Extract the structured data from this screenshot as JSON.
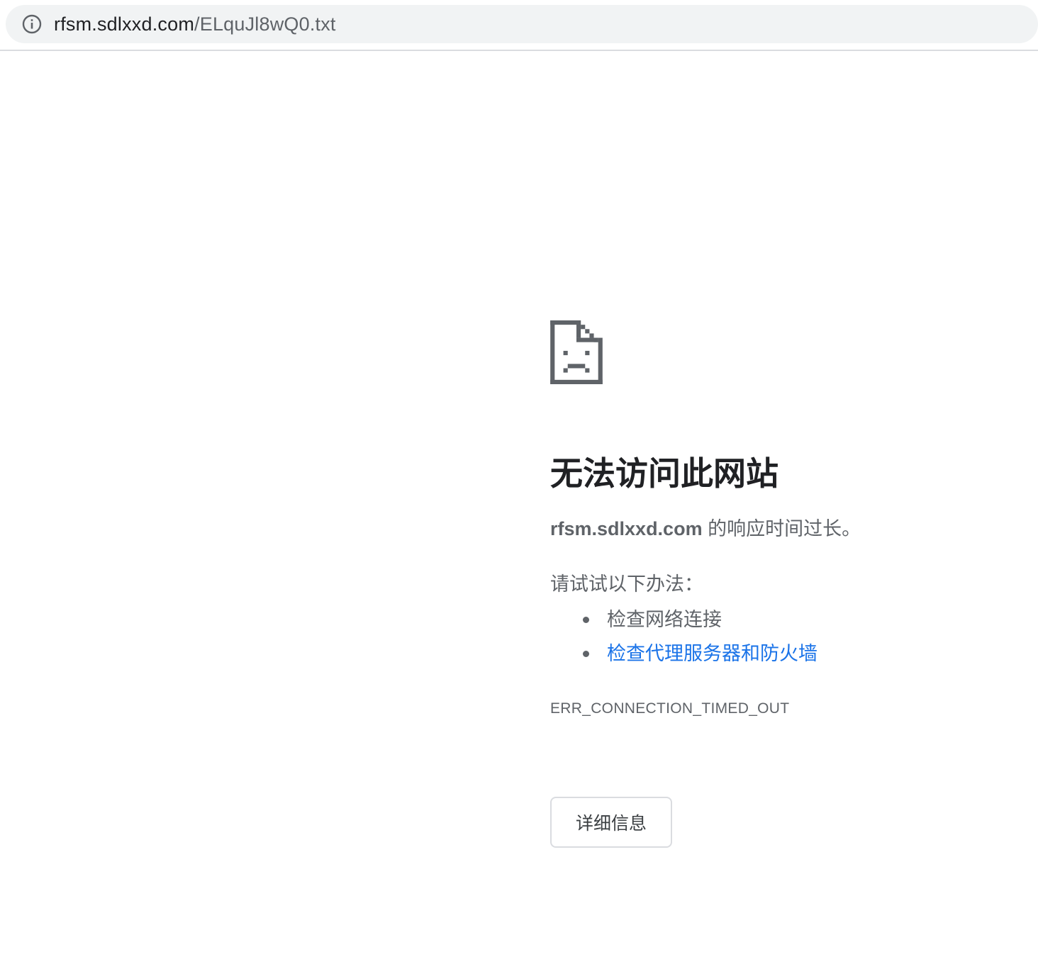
{
  "browser": {
    "url_host": "rfsm.sdlxxd.com",
    "url_path": "/ELquJl8wQ0.txt",
    "icons": {
      "site_info": "info-icon"
    }
  },
  "error_page": {
    "icon": "sad-page-icon",
    "title": "无法访问此网站",
    "summary_host": "rfsm.sdlxxd.com",
    "summary_text": " 的响应时间过长。",
    "suggestions_heading": "请试试以下办法：",
    "suggestions": [
      {
        "label": "检查网络连接",
        "is_link": false
      },
      {
        "label": "检查代理服务器和防火墙",
        "is_link": true
      }
    ],
    "error_code": "ERR_CONNECTION_TIMED_OUT",
    "details_button": "详细信息"
  },
  "colors": {
    "text_primary": "#202124",
    "text_secondary": "#5f6368",
    "link": "#1a73e8",
    "omnibox_bg": "#f1f3f4",
    "border": "#dadce0"
  }
}
